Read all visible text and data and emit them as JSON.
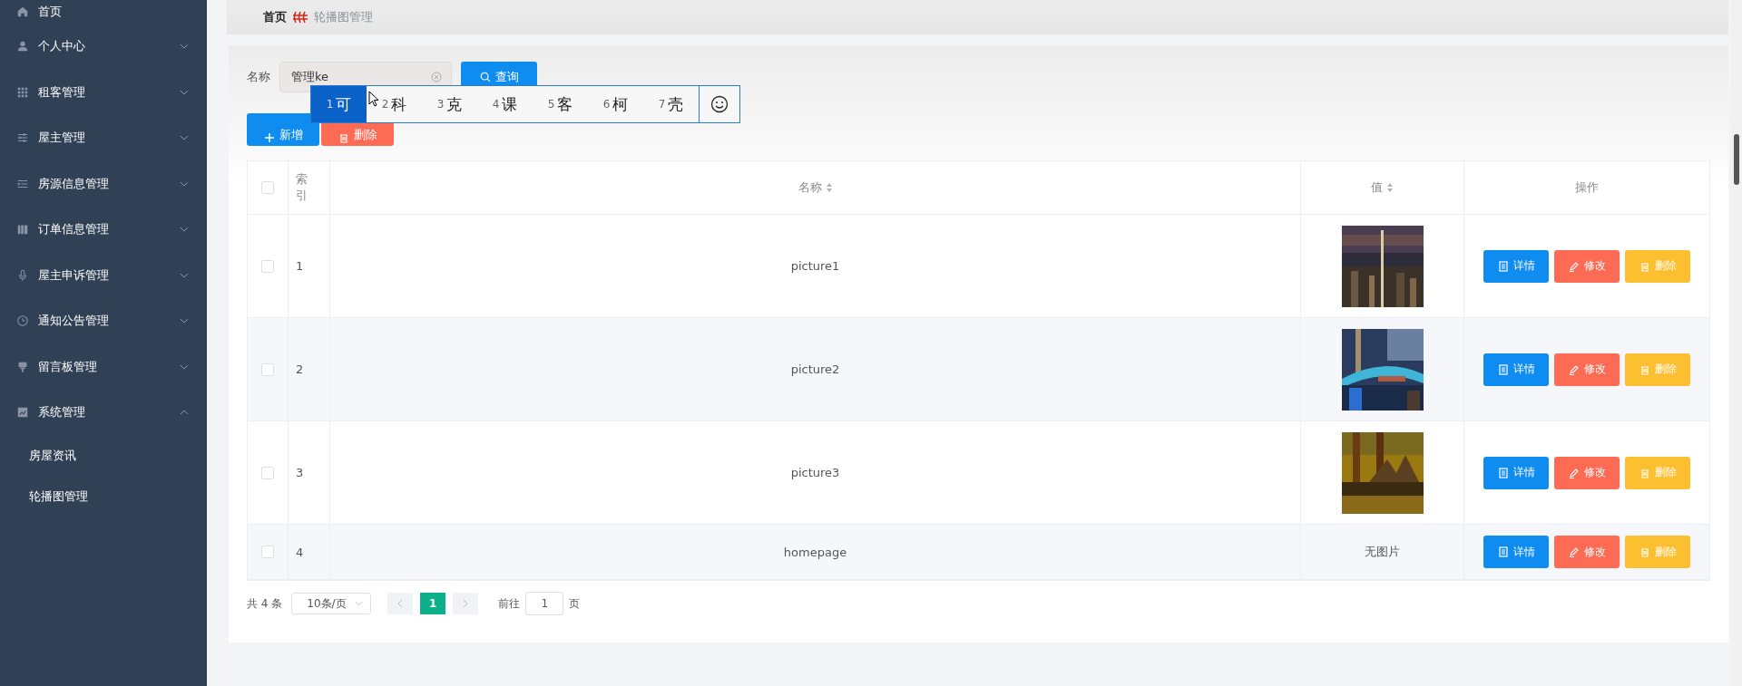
{
  "sidebar": {
    "items": [
      {
        "label": "首页",
        "kind": "link"
      },
      {
        "label": "个人中心",
        "kind": "menu",
        "expanded": false
      },
      {
        "label": "租客管理",
        "kind": "menu",
        "expanded": false
      },
      {
        "label": "屋主管理",
        "kind": "menu",
        "expanded": false
      },
      {
        "label": "房源信息管理",
        "kind": "menu",
        "expanded": false
      },
      {
        "label": "订单信息管理",
        "kind": "menu",
        "expanded": false
      },
      {
        "label": "屋主申诉管理",
        "kind": "menu",
        "expanded": false
      },
      {
        "label": "通知公告管理",
        "kind": "menu",
        "expanded": false
      },
      {
        "label": "留言板管理",
        "kind": "menu",
        "expanded": false
      },
      {
        "label": "系统管理",
        "kind": "menu",
        "expanded": true,
        "children": [
          {
            "label": "房屋资讯"
          },
          {
            "label": "轮播图管理"
          }
        ]
      }
    ]
  },
  "breadcrumb": [
    "首页",
    "轮播图管理"
  ],
  "search": {
    "label": "名称",
    "value": "管理ke",
    "button": "查询"
  },
  "ime": {
    "candidates": [
      {
        "number": "1",
        "text": "可",
        "selected": true
      },
      {
        "number": "2",
        "text": "科",
        "selected": false
      },
      {
        "number": "3",
        "text": "克",
        "selected": false
      },
      {
        "number": "4",
        "text": "课",
        "selected": false
      },
      {
        "number": "5",
        "text": "客",
        "selected": false
      },
      {
        "number": "6",
        "text": "柯",
        "selected": false
      },
      {
        "number": "7",
        "text": "壳",
        "selected": false
      }
    ]
  },
  "actions": {
    "add": "新增",
    "delete": "删除"
  },
  "table": {
    "columns": [
      "索引",
      "名称",
      "值",
      "操作"
    ],
    "header_checked": false,
    "rows": [
      {
        "checked": false,
        "index": "1",
        "name": "picture1",
        "value": {
          "kind": "picture"
        },
        "buttons": [
          "详情",
          "修改",
          "删除"
        ]
      },
      {
        "checked": false,
        "index": "2",
        "name": "picture2",
        "value": {
          "kind": "picture"
        },
        "buttons": [
          "详情",
          "修改",
          "删除"
        ]
      },
      {
        "checked": false,
        "index": "3",
        "name": "picture3",
        "value": {
          "kind": "picture"
        },
        "buttons": [
          "详情",
          "修改",
          "删除"
        ]
      },
      {
        "checked": false,
        "index": "4",
        "name": "homepage",
        "value": {
          "kind": "text",
          "text": "无图片"
        },
        "buttons": [
          "详情",
          "修改",
          "删除"
        ]
      }
    ]
  },
  "pagination": {
    "total": "共 4 条",
    "page_size": "10条/页",
    "pages": [
      {
        "label": "1",
        "selected": true
      }
    ],
    "goto_label": "前往",
    "goto_value": "1",
    "page_suffix": "页"
  }
}
